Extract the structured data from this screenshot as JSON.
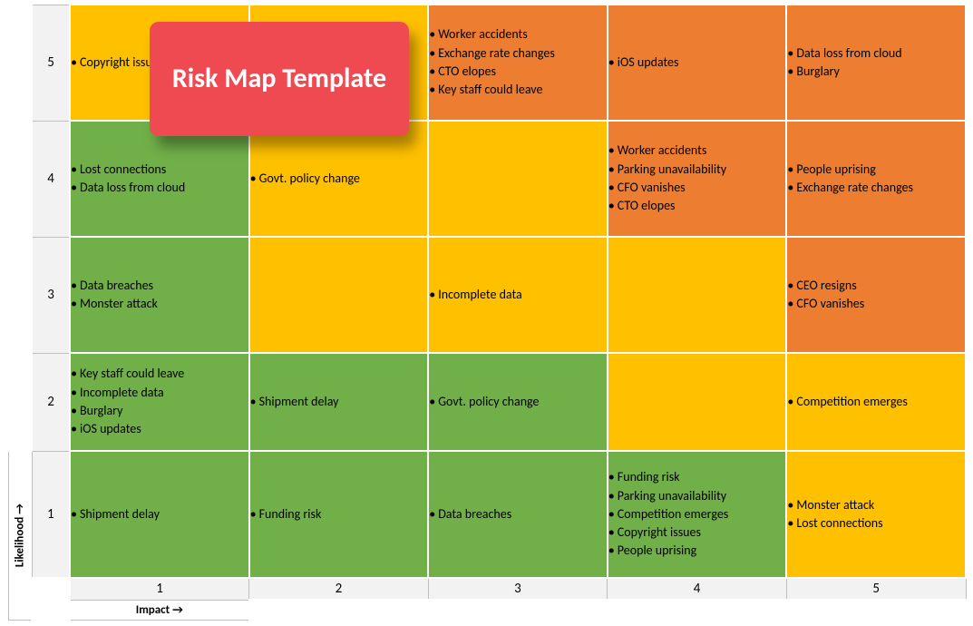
{
  "title_card": "Risk Map Template",
  "axes": {
    "y_label": "Likelihood →",
    "x_label": "Impact →",
    "rows": [
      "5",
      "4",
      "3",
      "2",
      "1"
    ],
    "cols": [
      "1",
      "2",
      "3",
      "4",
      "5"
    ]
  },
  "colors": {
    "green": "#71af48",
    "yellow": "#ffc000",
    "orange": "#ed7d31",
    "card": "#ef4a52"
  },
  "grid": [
    [
      {
        "color": "yellow",
        "items": [
          "Copyright issues"
        ]
      },
      {
        "color": "yellow",
        "items": []
      },
      {
        "color": "orange",
        "items": [
          "Worker accidents",
          "Exchange rate changes",
          "CTO elopes",
          "Key staff could leave"
        ]
      },
      {
        "color": "orange",
        "items": [
          "iOS updates"
        ]
      },
      {
        "color": "orange",
        "items": [
          "Data loss from cloud",
          "Burglary"
        ]
      }
    ],
    [
      {
        "color": "green",
        "items": [
          "Lost connections",
          "Data loss from cloud"
        ]
      },
      {
        "color": "yellow",
        "items": [
          "Govt. policy change"
        ]
      },
      {
        "color": "yellow",
        "items": []
      },
      {
        "color": "orange",
        "items": [
          "Worker accidents",
          "Parking unavailability",
          "CFO vanishes",
          "CTO elopes"
        ]
      },
      {
        "color": "orange",
        "items": [
          "People uprising",
          "Exchange rate changes"
        ]
      }
    ],
    [
      {
        "color": "green",
        "items": [
          "Data breaches",
          "Monster attack"
        ]
      },
      {
        "color": "yellow",
        "items": []
      },
      {
        "color": "yellow",
        "items": [
          "Incomplete data"
        ]
      },
      {
        "color": "yellow",
        "items": []
      },
      {
        "color": "orange",
        "items": [
          "CEO resigns",
          "CFO vanishes"
        ]
      }
    ],
    [
      {
        "color": "green",
        "items": [
          "Key staff could leave",
          "Incomplete data",
          "Burglary",
          "iOS updates"
        ]
      },
      {
        "color": "green",
        "items": [
          "Shipment delay"
        ]
      },
      {
        "color": "green",
        "items": [
          "Govt. policy change"
        ]
      },
      {
        "color": "yellow",
        "items": []
      },
      {
        "color": "yellow",
        "items": [
          "Competition emerges"
        ]
      }
    ],
    [
      {
        "color": "green",
        "items": [
          "Shipment delay"
        ]
      },
      {
        "color": "green",
        "items": [
          "Funding risk"
        ]
      },
      {
        "color": "green",
        "items": [
          "Data breaches"
        ]
      },
      {
        "color": "green",
        "items": [
          "Funding risk",
          "Parking unavailability",
          "Competition emerges",
          "Copyright issues",
          "People uprising"
        ]
      },
      {
        "color": "yellow",
        "items": [
          "Monster attack",
          "Lost connections"
        ]
      }
    ]
  ]
}
